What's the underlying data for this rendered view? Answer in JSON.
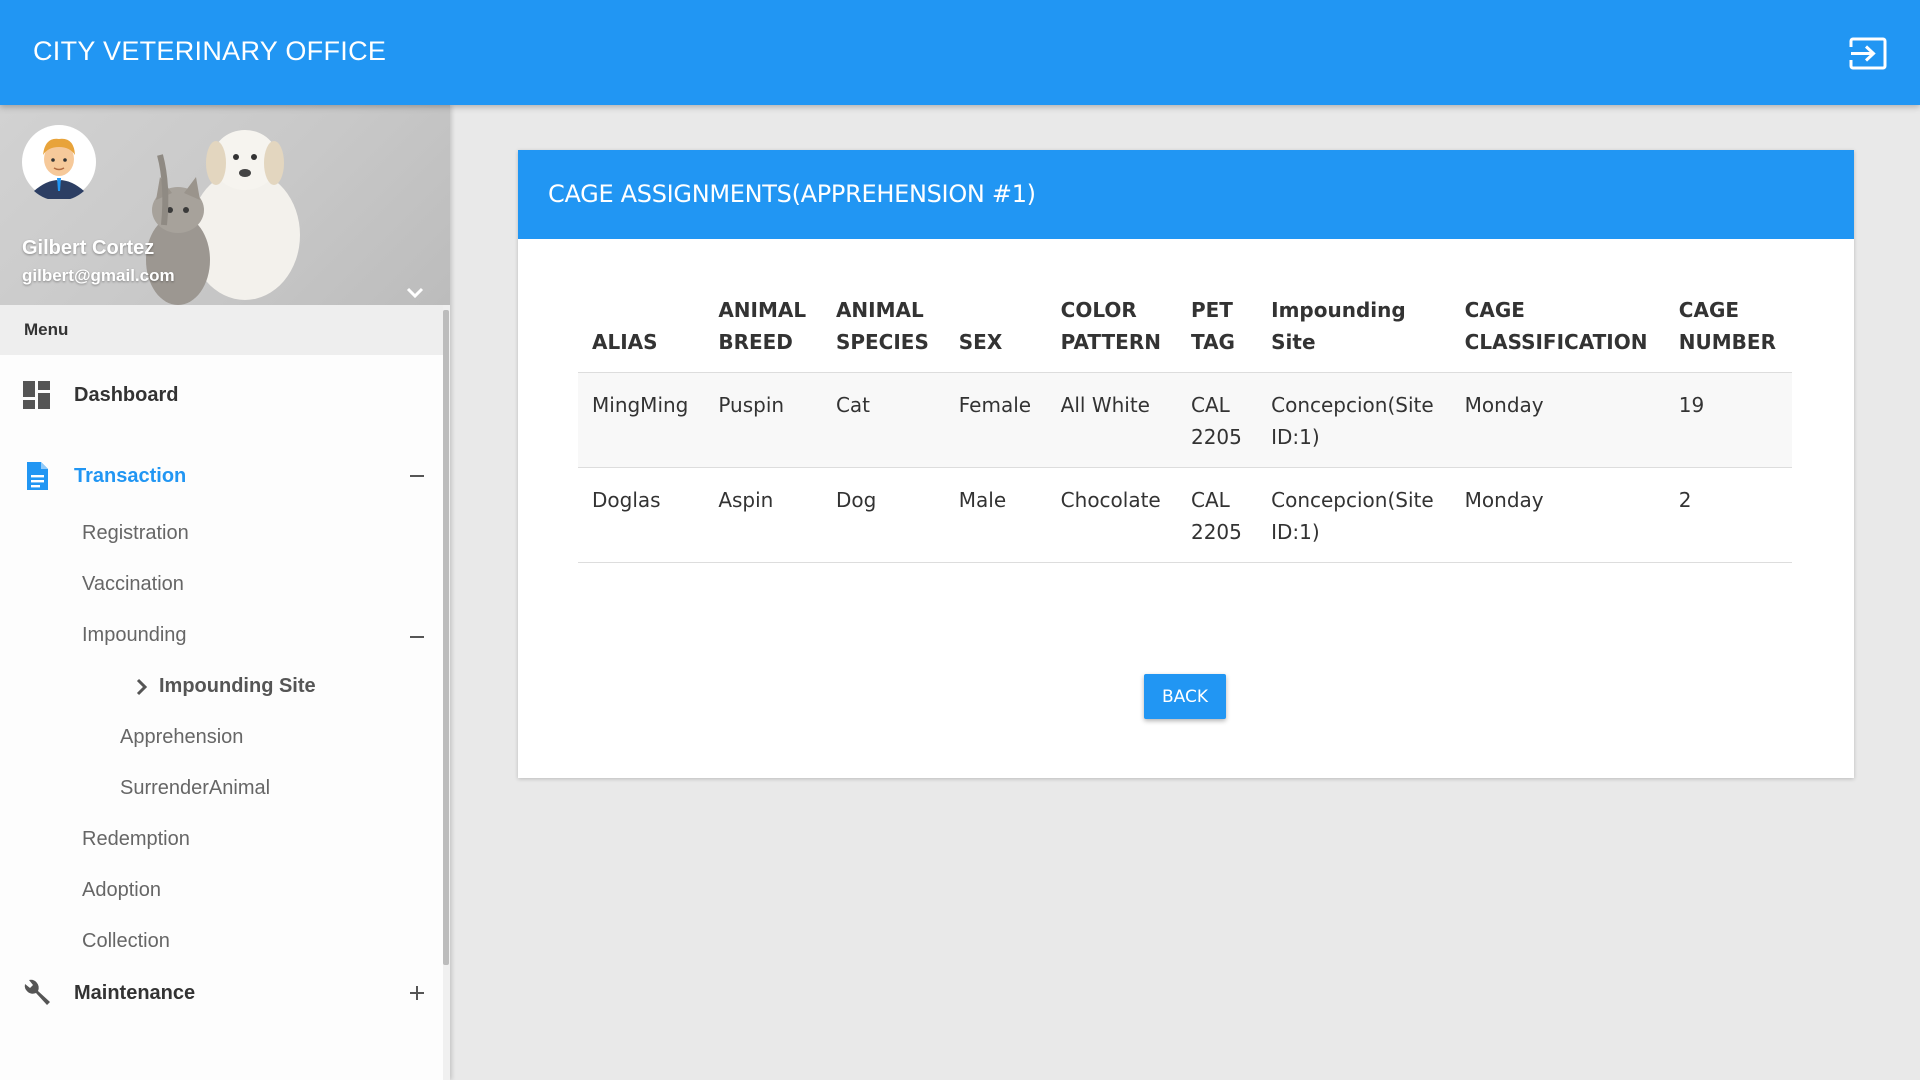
{
  "app": {
    "title": "CITY VETERINARY OFFICE"
  },
  "header": {
    "logout_icon": "exit-to-app-icon"
  },
  "user": {
    "name": "Gilbert Cortez",
    "email": "gilbert@gmail.com"
  },
  "sidebar": {
    "menu_label": "Menu",
    "items": [
      {
        "label": "Dashboard",
        "icon": "dashboard-icon"
      },
      {
        "label": "Transaction",
        "icon": "document-icon",
        "active": true,
        "toggle": "−"
      },
      {
        "label": "Maintenance",
        "icon": "wrench-icon",
        "toggle": "+"
      }
    ],
    "transaction_items": [
      "Registration",
      "Vaccination",
      "Impounding",
      "Redemption",
      "Adoption",
      "Collection"
    ],
    "impounding_toggle": "−",
    "impounding_items": [
      "Impounding Site",
      "Apprehension",
      "SurrenderAnimal"
    ]
  },
  "card": {
    "title": "CAGE ASSIGNMENTS(APPREHENSION #1)",
    "back_label": "BACK"
  },
  "table": {
    "columns": [
      [
        "ALIAS"
      ],
      [
        "ANIMAL",
        "BREED"
      ],
      [
        "ANIMAL",
        "SPECIES"
      ],
      [
        "SEX"
      ],
      [
        "COLOR",
        "PATTERN"
      ],
      [
        "PET",
        "TAG"
      ],
      [
        "Impounding",
        "Site"
      ],
      [
        "CAGE",
        "CLASSIFICATION"
      ],
      [
        "CAGE",
        "NUMBER"
      ]
    ],
    "rows": [
      [
        [
          "MingMing"
        ],
        [
          "Puspin"
        ],
        [
          "Cat"
        ],
        [
          "Female"
        ],
        [
          "All White"
        ],
        [
          "CAL",
          "2205"
        ],
        [
          "Concepcion(Site",
          "ID:1)"
        ],
        [
          "Monday"
        ],
        [
          "19"
        ]
      ],
      [
        [
          "Doglas"
        ],
        [
          "Aspin"
        ],
        [
          "Dog"
        ],
        [
          "Male"
        ],
        [
          "Chocolate"
        ],
        [
          "CAL",
          "2205"
        ],
        [
          "Concepcion(Site",
          "ID:1)"
        ],
        [
          "Monday"
        ],
        [
          "2"
        ]
      ]
    ]
  },
  "colors": {
    "primary": "#2196f3",
    "background": "#e9e9e9",
    "active_nav": "#2196f3"
  }
}
